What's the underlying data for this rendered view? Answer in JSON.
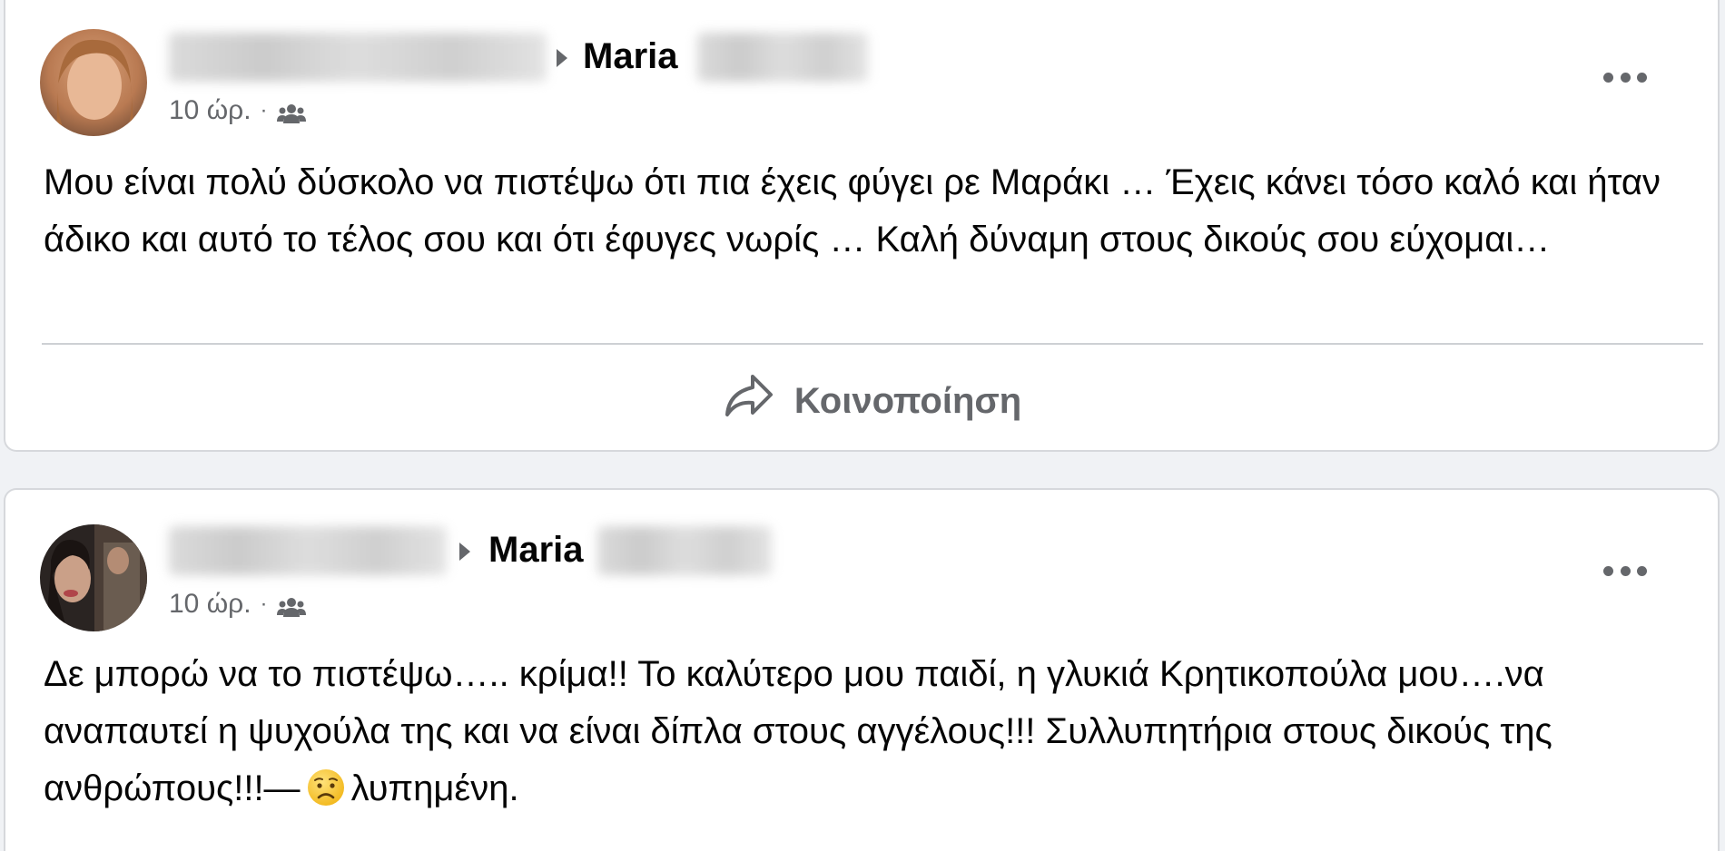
{
  "posts": [
    {
      "group_name": "Maria",
      "time": "10 ώρ.",
      "separator": "·",
      "text": "Μου είναι πολύ δύσκολο να πιστέψω ότι πια έχεις φύγει ρε Μαράκι … Έχεις κάνει τόσο καλό και ήταν άδικο και αυτό το τέλος σου και ότι έφυγες νωρίς … Καλή δύναμη στους δικούς σου εύχομαι…",
      "share_label": "Κοινοποίηση"
    },
    {
      "group_name": "Maria",
      "time": "10 ώρ.",
      "separator": "·",
      "text_before_emoji": "Δε μπορώ να το πιστέψω….. κρίμα!! Το καλύτερο μου παιδί, η γλυκιά Κρητικοπούλα μου….να αναπαυτεί η ψυχούλα της και να είναι δίπλα στους αγγέλους!!! Συλλυπητήρια στους δικούς της ανθρώπους!!!—",
      "feeling": "λυπημένη."
    }
  ],
  "colors": {
    "primary_text": "#050505",
    "secondary_text": "#65676b",
    "divider": "#ced0d4",
    "card_border": "#d6d8dc",
    "background": "#f0f2f5"
  },
  "icons": [
    "group-audience-icon",
    "more-options-icon",
    "share-icon",
    "sad-face-emoji-icon",
    "right-triangle-icon"
  ]
}
